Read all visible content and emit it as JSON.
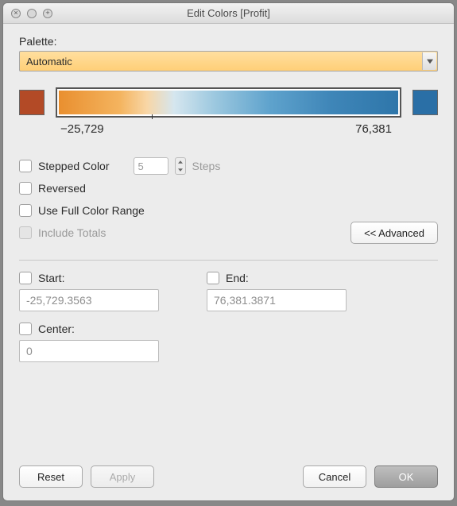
{
  "window": {
    "title": "Edit Colors [Profit]"
  },
  "palette": {
    "label": "Palette:",
    "selected": "Automatic"
  },
  "range": {
    "min_label": "−25,729",
    "max_label": "76,381"
  },
  "options": {
    "stepped_label": "Stepped Color",
    "steps_value": "5",
    "steps_label": "Steps",
    "reversed_label": "Reversed",
    "full_range_label": "Use Full Color Range",
    "include_totals_label": "Include Totals",
    "advanced_label": "<<  Advanced"
  },
  "advanced": {
    "start_label": "Start:",
    "start_value": "-25,729.3563",
    "end_label": "End:",
    "end_value": "76,381.3871",
    "center_label": "Center:",
    "center_value": "0"
  },
  "buttons": {
    "reset": "Reset",
    "apply": "Apply",
    "cancel": "Cancel",
    "ok": "OK"
  },
  "colors": {
    "min_swatch": "#b34a26",
    "max_swatch": "#2a6fa6"
  }
}
